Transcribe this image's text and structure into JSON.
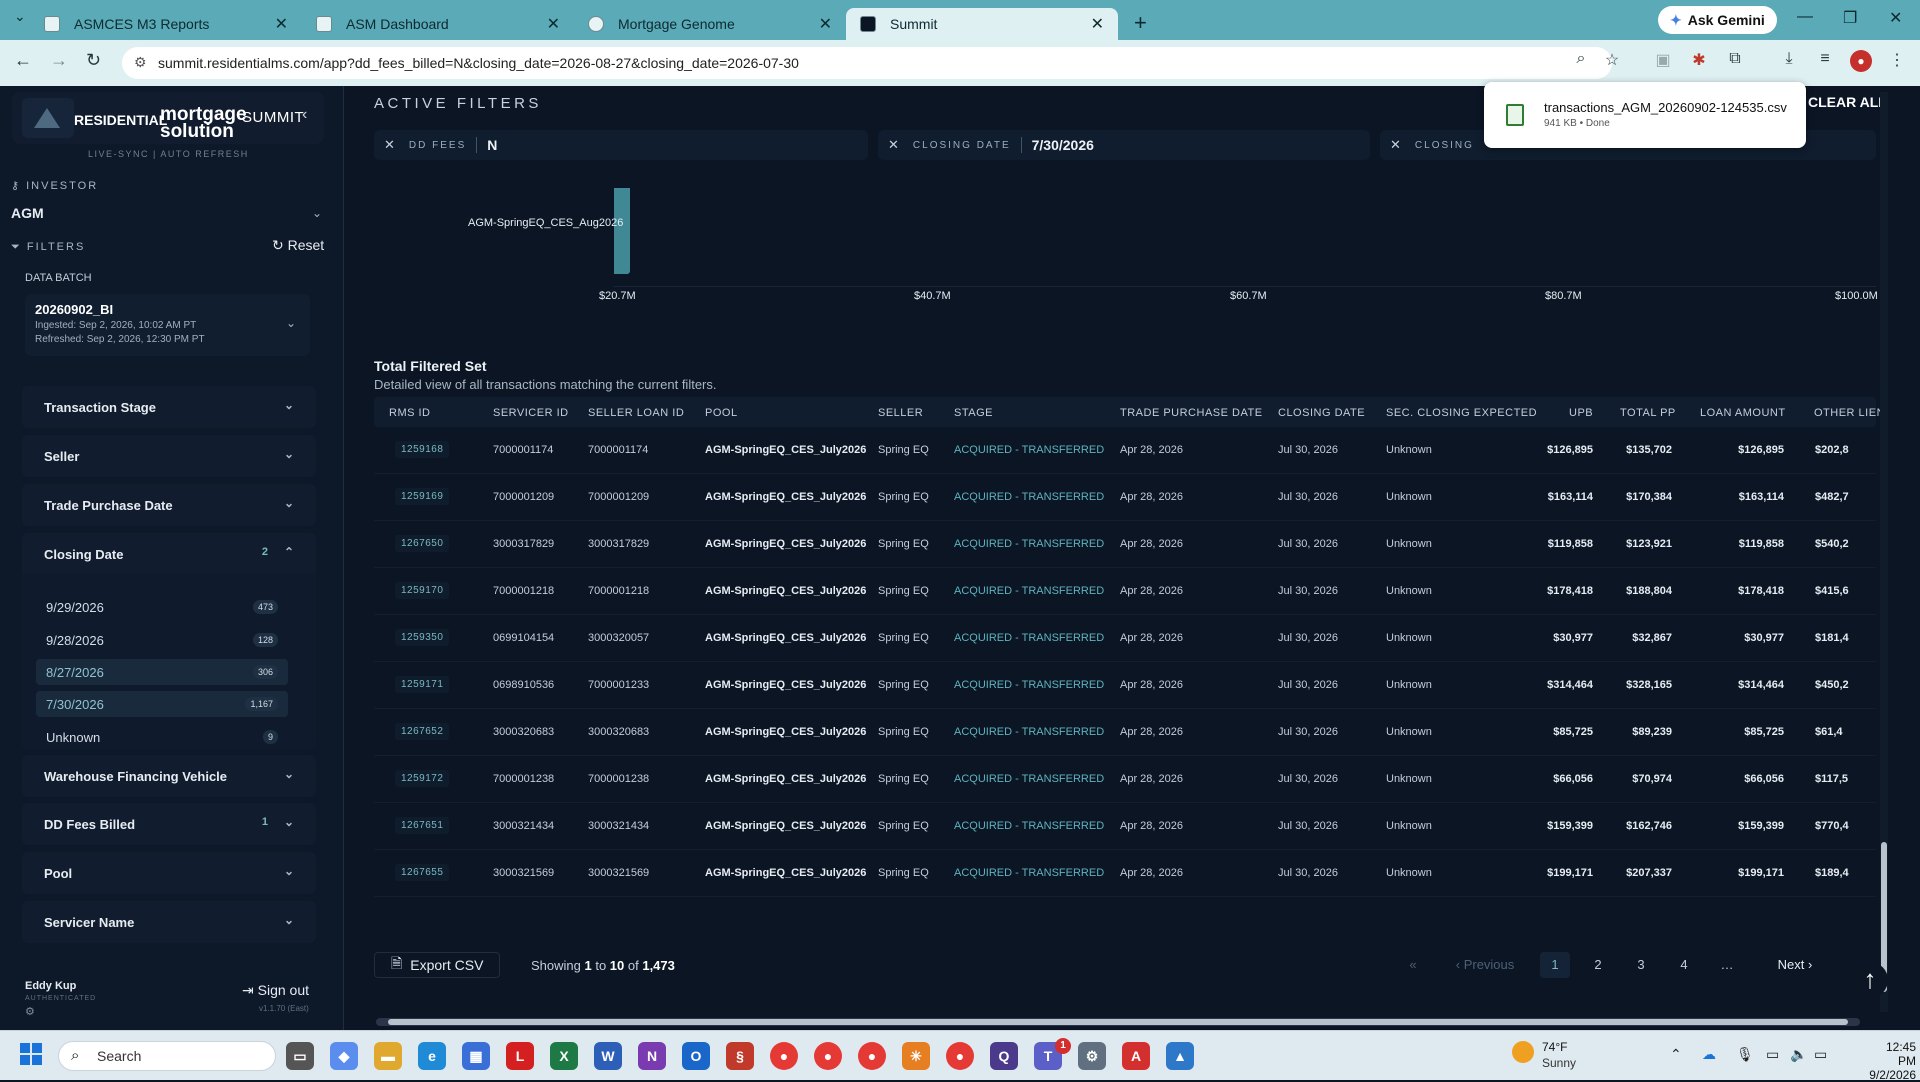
{
  "browser": {
    "tabs": [
      {
        "title": "ASMCES M3 Reports"
      },
      {
        "title": "ASM Dashboard"
      },
      {
        "title": "Mortgage Genome"
      },
      {
        "title": "Summit"
      }
    ],
    "gemini": "Ask Gemini",
    "url": "summit.residentialms.com/app?dd_fees_billed=N&closing_date=2026-08-27&closing_date=2026-07-30"
  },
  "download": {
    "filename": "transactions_AGM_20260902-124535.csv",
    "status": "941 KB • Done"
  },
  "sidebar": {
    "brand_left": "RESIDENTIAL",
    "brand_mid": "mortgage solution",
    "brand_right": "SUMMIT",
    "sync": "LIVE-SYNC  |  AUTO REFRESH",
    "investor_label": "INVESTOR",
    "investor_value": "AGM",
    "filters_label": "FILTERS",
    "reset": "Reset",
    "batch_label": "DATA BATCH",
    "batch_id": "20260902_BI",
    "batch_ingested": "Ingested: Sep 2, 2026, 10:02 AM PT",
    "batch_refreshed": "Refreshed: Sep 2, 2026, 12:30 PM PT",
    "filters": [
      {
        "label": "Transaction Stage"
      },
      {
        "label": "Seller"
      },
      {
        "label": "Trade Purchase Date"
      },
      {
        "label": "Closing Date",
        "count": "2"
      },
      {
        "label": "Warehouse Financing Vehicle"
      },
      {
        "label": "DD Fees Billed",
        "count": "1"
      },
      {
        "label": "Pool"
      },
      {
        "label": "Servicer Name"
      }
    ],
    "closing_options": [
      {
        "label": "9/29/2026",
        "count": "473"
      },
      {
        "label": "9/28/2026",
        "count": "128"
      },
      {
        "label": "8/27/2026",
        "count": "306"
      },
      {
        "label": "7/30/2026",
        "count": "1,167"
      },
      {
        "label": "Unknown",
        "count": "9"
      }
    ],
    "user": "Eddy Kup",
    "auth": "AUTHENTICATED",
    "signout": "Sign out",
    "version": "v1.1.70 (East)"
  },
  "main": {
    "active_filters": "ACTIVE FILTERS",
    "clear_all": "CLEAR ALL",
    "chips": [
      {
        "key": "DD FEES",
        "value": "N"
      },
      {
        "key": "CLOSING DATE",
        "value": "7/30/2026"
      },
      {
        "key": "CLOSING",
        "value": ""
      }
    ],
    "section_title": "Total Filtered Set",
    "section_sub": "Detailed view of all transactions matching the current filters.",
    "columns": [
      "RMS ID",
      "SERVICER ID",
      "SELLER LOAN ID",
      "POOL",
      "SELLER",
      "STAGE",
      "TRADE PURCHASE DATE",
      "CLOSING DATE",
      "SEC. CLOSING EXPECTED",
      "UPB",
      "TOTAL PP",
      "LOAN AMOUNT",
      "OTHER LIEN"
    ],
    "rows": [
      [
        "1259168",
        "7000001174",
        "7000001174",
        "AGM-SpringEQ_CES_July2026",
        "Spring EQ",
        "ACQUIRED - TRANSFERRED",
        "Apr 28, 2026",
        "Jul 30, 2026",
        "Unknown",
        "$126,895",
        "$135,702",
        "$126,895",
        "$202,8"
      ],
      [
        "1259169",
        "7000001209",
        "7000001209",
        "AGM-SpringEQ_CES_July2026",
        "Spring EQ",
        "ACQUIRED - TRANSFERRED",
        "Apr 28, 2026",
        "Jul 30, 2026",
        "Unknown",
        "$163,114",
        "$170,384",
        "$163,114",
        "$482,7"
      ],
      [
        "1267650",
        "3000317829",
        "3000317829",
        "AGM-SpringEQ_CES_July2026",
        "Spring EQ",
        "ACQUIRED - TRANSFERRED",
        "Apr 28, 2026",
        "Jul 30, 2026",
        "Unknown",
        "$119,858",
        "$123,921",
        "$119,858",
        "$540,2"
      ],
      [
        "1259170",
        "7000001218",
        "7000001218",
        "AGM-SpringEQ_CES_July2026",
        "Spring EQ",
        "ACQUIRED - TRANSFERRED",
        "Apr 28, 2026",
        "Jul 30, 2026",
        "Unknown",
        "$178,418",
        "$188,804",
        "$178,418",
        "$415,6"
      ],
      [
        "1259350",
        "0699104154",
        "3000320057",
        "AGM-SpringEQ_CES_July2026",
        "Spring EQ",
        "ACQUIRED - TRANSFERRED",
        "Apr 28, 2026",
        "Jul 30, 2026",
        "Unknown",
        "$30,977",
        "$32,867",
        "$30,977",
        "$181,4"
      ],
      [
        "1259171",
        "0698910536",
        "7000001233",
        "AGM-SpringEQ_CES_July2026",
        "Spring EQ",
        "ACQUIRED - TRANSFERRED",
        "Apr 28, 2026",
        "Jul 30, 2026",
        "Unknown",
        "$314,464",
        "$328,165",
        "$314,464",
        "$450,2"
      ],
      [
        "1267652",
        "3000320683",
        "3000320683",
        "AGM-SpringEQ_CES_July2026",
        "Spring EQ",
        "ACQUIRED - TRANSFERRED",
        "Apr 28, 2026",
        "Jul 30, 2026",
        "Unknown",
        "$85,725",
        "$89,239",
        "$85,725",
        "$61,4"
      ],
      [
        "1259172",
        "7000001238",
        "7000001238",
        "AGM-SpringEQ_CES_July2026",
        "Spring EQ",
        "ACQUIRED - TRANSFERRED",
        "Apr 28, 2026",
        "Jul 30, 2026",
        "Unknown",
        "$66,056",
        "$70,974",
        "$66,056",
        "$117,5"
      ],
      [
        "1267651",
        "3000321434",
        "3000321434",
        "AGM-SpringEQ_CES_July2026",
        "Spring EQ",
        "ACQUIRED - TRANSFERRED",
        "Apr 28, 2026",
        "Jul 30, 2026",
        "Unknown",
        "$159,399",
        "$162,746",
        "$159,399",
        "$770,4"
      ],
      [
        "1267655",
        "3000321569",
        "3000321569",
        "AGM-SpringEQ_CES_July2026",
        "Spring EQ",
        "ACQUIRED - TRANSFERRED",
        "Apr 28, 2026",
        "Jul 30, 2026",
        "Unknown",
        "$199,171",
        "$207,337",
        "$199,171",
        "$189,4"
      ]
    ],
    "export": "Export CSV",
    "showing": {
      "prefix": "Showing ",
      "from": "1",
      "mid1": " to ",
      "to": "10",
      "mid2": " of ",
      "total": "1,473"
    },
    "pagination": {
      "first": "«",
      "previous": "Previous",
      "pages": [
        "1",
        "2",
        "3",
        "4",
        "…"
      ],
      "next": "Next",
      "last": "»"
    }
  },
  "chart_data": {
    "type": "bar",
    "orientation": "horizontal",
    "categories": [
      "AGM-SpringEQ_CES_Aug2026"
    ],
    "values": [
      20.7
    ],
    "xticks": [
      "$20.7M",
      "$40.7M",
      "$60.7M",
      "$80.7M",
      "$100.0M"
    ],
    "xlim": [
      20.7,
      100.0
    ]
  },
  "taskbar": {
    "search": "Search",
    "temp": "74°F",
    "cond": "Sunny",
    "time": "12:45 PM",
    "date": "9/2/2026",
    "badge": "1"
  },
  "colors": {
    "accent": "#5fb3bf",
    "bg": "#0b1524",
    "tabbar": "#5aaab7"
  }
}
